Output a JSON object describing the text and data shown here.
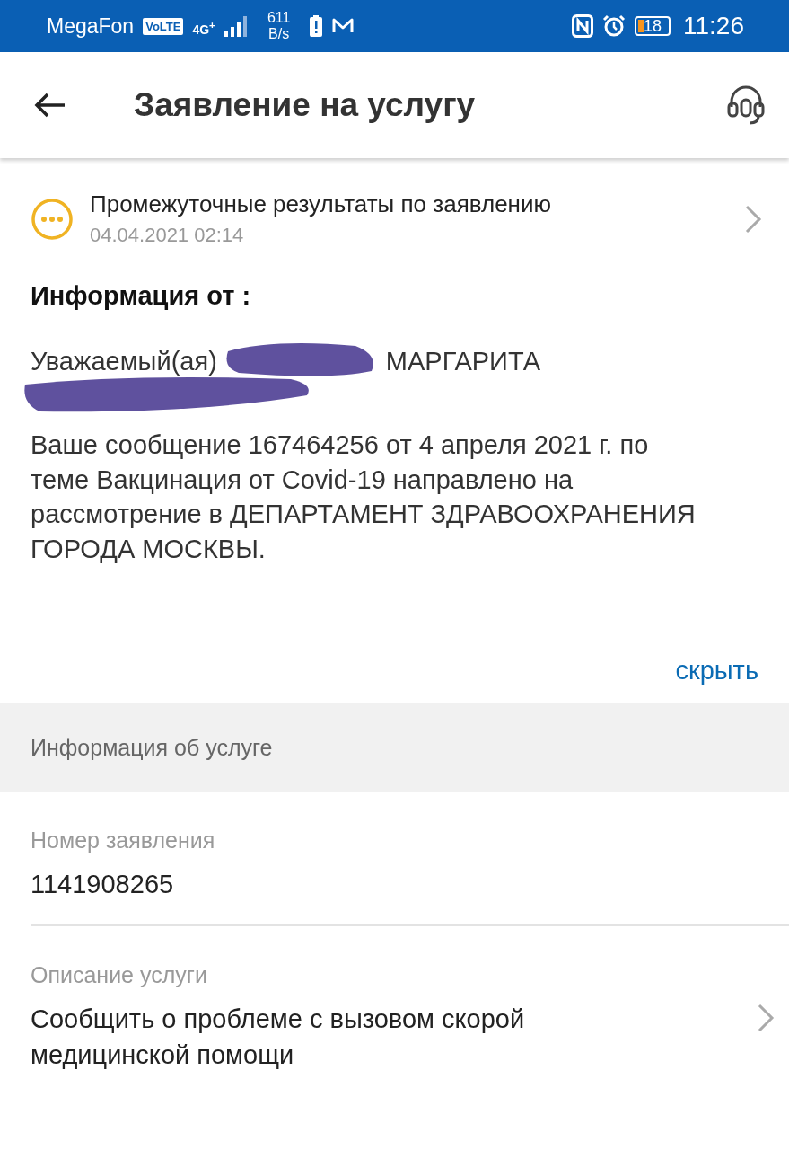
{
  "status_bar": {
    "carrier": "MegaFon",
    "volte": "VoLTE",
    "network": "4G$^{+}$",
    "speed": "611",
    "speed_unit": "B/s",
    "battery": "18",
    "time": "11:26"
  },
  "header": {
    "title": "Заявление на услугу"
  },
  "status_item": {
    "title": "Промежуточные результаты по заявлению",
    "date": "04.04.2021 02:14"
  },
  "info": {
    "heading": "Информация от :",
    "greeting": "Уважаемый(ая)",
    "name_visible": "МАРГАРИТА",
    "message": "Ваше сообщение 167464256 от 4 апреля 2021 г. по теме Вакцинация от Covid-19 направлено на рассмотрение в ДЕПАРТАМЕНТ ЗДРАВООХРАНЕНИЯ ГОРОДА МОСКВЫ.",
    "hide_link": "скрыть"
  },
  "section": {
    "title": "Информация об услуге"
  },
  "fields": [
    {
      "kind": "plain",
      "label": "Номер заявления",
      "value": "1141908265"
    },
    {
      "kind": "link",
      "label": "Описание услуги",
      "value": "Сообщить о проблеме с вызовом скорой медицинской помощи"
    }
  ]
}
